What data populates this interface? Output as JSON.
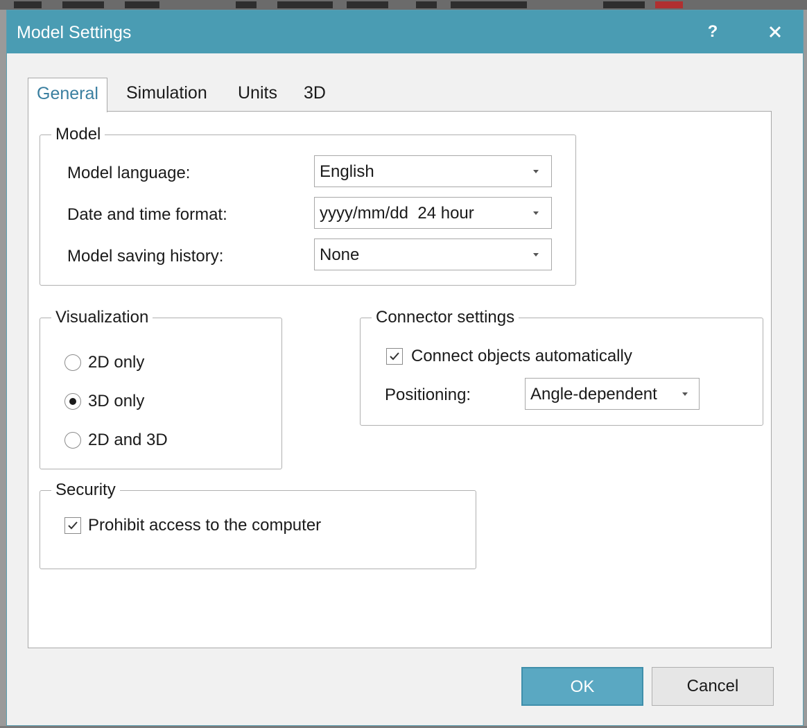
{
  "dialog": {
    "title": "Model Settings",
    "help_label": "?",
    "close_icon": "close-icon"
  },
  "tabs": [
    {
      "label": "General",
      "active": true
    },
    {
      "label": "Simulation",
      "active": false
    },
    {
      "label": "Units",
      "active": false
    },
    {
      "label": "3D",
      "active": false
    }
  ],
  "model_group": {
    "legend": "Model",
    "language": {
      "label": "Model language:",
      "value": "English"
    },
    "datetime": {
      "label": "Date and time format:",
      "value": "yyyy/mm/dd  24 hour"
    },
    "history": {
      "label": "Model saving history:",
      "value": "None"
    }
  },
  "visualization_group": {
    "legend": "Visualization",
    "options": [
      {
        "label": "2D only",
        "selected": false
      },
      {
        "label": "3D only",
        "selected": true
      },
      {
        "label": "2D and 3D",
        "selected": false
      }
    ]
  },
  "connector_group": {
    "legend": "Connector settings",
    "auto_connect": {
      "label": "Connect objects automatically",
      "checked": true
    },
    "positioning": {
      "label": "Positioning:",
      "value": "Angle-dependent"
    }
  },
  "security_group": {
    "legend": "Security",
    "prohibit": {
      "label": "Prohibit access to the computer",
      "checked": true
    }
  },
  "buttons": {
    "ok": "OK",
    "cancel": "Cancel"
  },
  "colors": {
    "titlebar": "#4a9cb3",
    "accent": "#5aa8c2",
    "active_tab_text": "#3a7fa0"
  }
}
